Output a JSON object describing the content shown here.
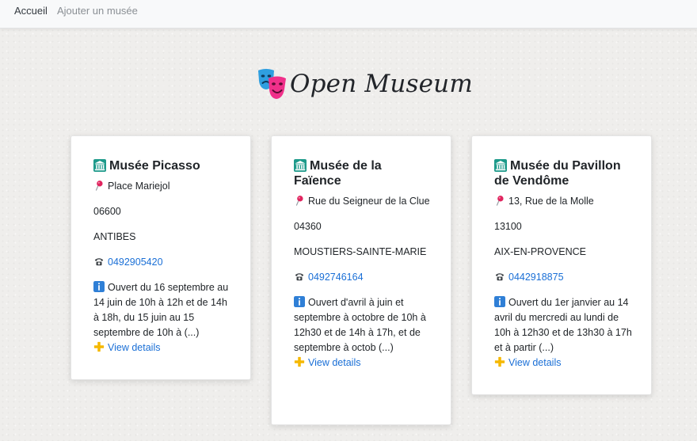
{
  "nav": {
    "home_label": "Accueil",
    "add_label": "Ajouter un musée"
  },
  "brand": {
    "title": "Open Museum",
    "icon": "theater-masks-icon"
  },
  "icons": {
    "museum": "classical-building-icon",
    "address": "round-pushpin-icon",
    "phone": "telephone-icon",
    "info": "information-icon",
    "details": "plus-icon"
  },
  "colors": {
    "link": "#1a6fd6",
    "info_icon": "#2f7fd6",
    "plus_icon": "#f5b800",
    "pin": "#e0245e"
  },
  "museums": [
    {
      "name": "Musée Picasso",
      "address": "Place Mariejol",
      "postcode": "06600",
      "city": "ANTIBES",
      "phone": "0492905420",
      "hours": "Ouvert du 16 septembre au 14 juin de 10h à 12h et de 14h à 18h, du 15 juin au 15 septembre de 10h à (...)",
      "details_label": "View details"
    },
    {
      "name": "Musée de la Faïence",
      "address": "Rue du Seigneur de la Clue",
      "postcode": "04360",
      "city": "MOUSTIERS-SAINTE-MARIE",
      "phone": "0492746164",
      "hours": "Ouvert d'avril à juin et septembre à octobre de 10h à 12h30 et de 14h à 17h, et de septembre à octob (...)",
      "details_label": "View details"
    },
    {
      "name": "Musée du Pavillon de Vendôme",
      "address": "13, Rue de la Molle",
      "postcode": "13100",
      "city": "AIX-EN-PROVENCE",
      "phone": "0442918875",
      "hours": "Ouvert du 1er janvier au 14 avril du mercredi au lundi de 10h à 12h30 et de 13h30 à 17h et à partir (...)",
      "details_label": "View details"
    }
  ]
}
